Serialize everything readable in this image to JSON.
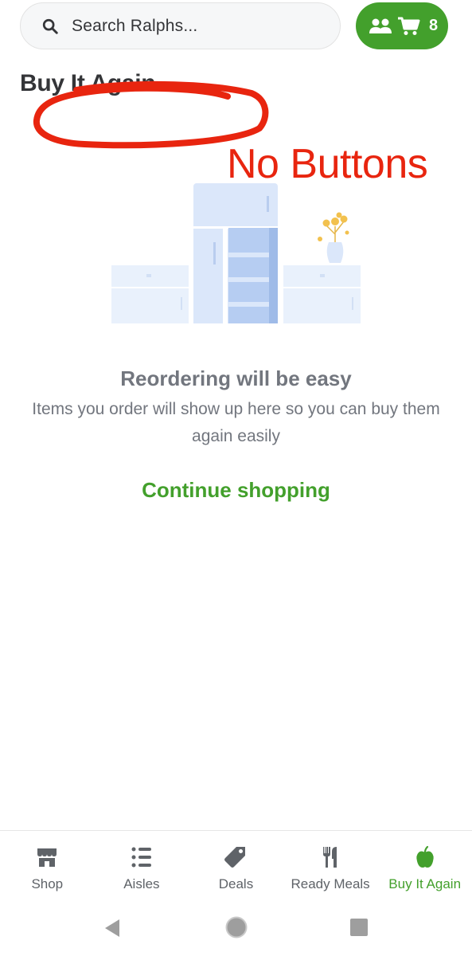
{
  "header": {
    "search_placeholder": "Search Ralphs...",
    "cart_count": "8"
  },
  "page": {
    "title": "Buy It Again"
  },
  "annotation": {
    "text": "No Buttons",
    "color": "#e8250f"
  },
  "empty_state": {
    "title": "Reordering will be easy",
    "body": "Items you order will show up here so you can buy them again easily",
    "action_label": "Continue shopping"
  },
  "bottom_nav": {
    "items": [
      {
        "label": "Shop",
        "icon": "store-icon"
      },
      {
        "label": "Aisles",
        "icon": "list-icon"
      },
      {
        "label": "Deals",
        "icon": "tag-icon"
      },
      {
        "label": "Ready Meals",
        "icon": "utensils-icon"
      },
      {
        "label": "Buy It Again",
        "icon": "apple-icon",
        "active": true
      }
    ]
  },
  "colors": {
    "brand_green": "#43a02c",
    "text_muted": "#72767e"
  }
}
